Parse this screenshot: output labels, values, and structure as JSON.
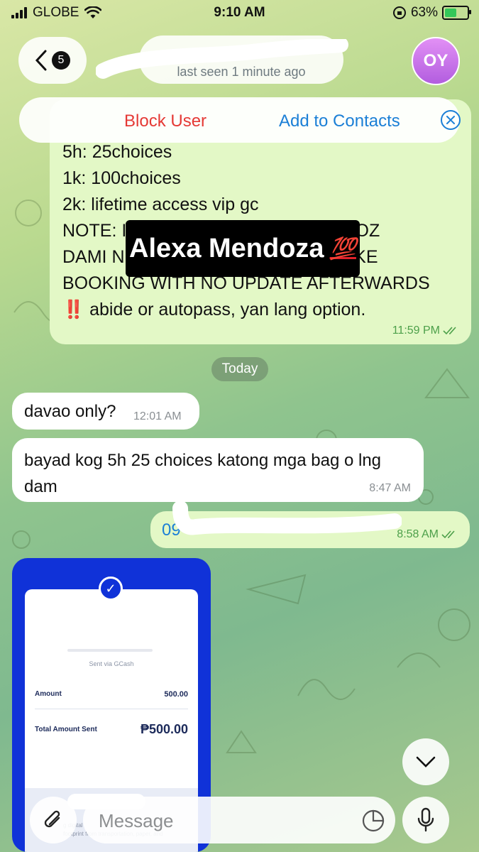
{
  "status_bar": {
    "carrier": "GLOBE",
    "time": "9:10 AM",
    "battery_percent": "63%",
    "battery_level": 0.63
  },
  "header": {
    "unread_count": "5",
    "last_seen": "last seen 1 minute ago",
    "avatar_initials": "OY"
  },
  "action_bar": {
    "block_label": "Block User",
    "add_contact_label": "Add to Contacts"
  },
  "messages": {
    "pinned_out": {
      "lines": [
        "5h: 25choices",
        "1k: 100choices",
        "2k: lifetime access vip gc",
        "NOTE: I                                        G COZ",
        "DAMI N                                        D LIKE",
        "BOOKING WITH NO UPDATE AFTERWARDS"
      ],
      "last_line": "abide or autopass, yan lang option.",
      "last_line_emoji": "‼️",
      "time": "11:59 PM"
    },
    "overlay_name": "Alexa Mendoza",
    "overlay_emoji": "💯",
    "date_separator": "Today",
    "in_1": {
      "text": "davao only?",
      "time": "12:01 AM"
    },
    "in_2": {
      "text": "bayad kog 5h 25 choices katong mga bag o lng dam",
      "time": "8:47 AM"
    },
    "out_2": {
      "text": "09",
      "time": "8:58 AM"
    }
  },
  "gcash_receipt": {
    "sent_via": "Sent via GCash",
    "amount_label": "Amount",
    "amount_value": "500.00",
    "total_label": "Total Amount Sent",
    "total_value": "₱500.00",
    "footer_text_1": "g digital",
    "footer_text_2": "footprint from transportation, paper, and"
  },
  "composer": {
    "placeholder": "Message"
  },
  "colors": {
    "block": "#e53935",
    "link": "#1b7fd6",
    "outgoing_bubble": "#e3f8c6",
    "gcash_blue": "#1032d8"
  }
}
